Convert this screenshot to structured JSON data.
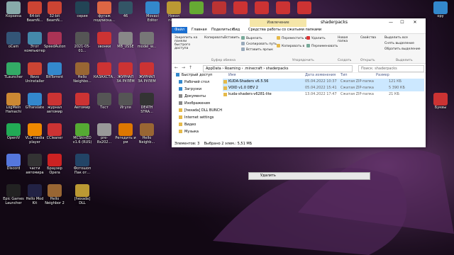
{
  "desktop": {
    "icons": [
      {
        "label": "Корзина",
        "color": "#8aa",
        "name": "recycle-bin-icon"
      },
      {
        "label": "64-bit\nBeamN...",
        "color": "#c43",
        "name": "beamng-64-icon"
      },
      {
        "label": "32-bit\nBeamN...",
        "color": "#c43",
        "name": "beamng-32-icon"
      },
      {
        "label": "серия",
        "color": "#245",
        "name": "folder-serial-icon"
      },
      {
        "label": "футаж\nподписка...",
        "color": "#d64",
        "name": "footage-icon"
      },
      {
        "label": "46",
        "color": "#356",
        "name": "file-46-icon"
      },
      {
        "label": "Movavi\nEditor",
        "color": "#38c",
        "name": "movavi-editor-icon"
      },
      {
        "label": "Новая\nпапка",
        "color": "#b93",
        "name": "new-folder-icon"
      },
      {
        "label": "",
        "color": "#6a3",
        "name": "winrar-icon"
      },
      {
        "label": "",
        "color": "#b33",
        "name": "game-archive-icon"
      },
      {
        "label": "",
        "color": "#c33",
        "name": "pdf-icon"
      },
      {
        "label": "",
        "color": "#c33",
        "name": "pdf-2-icon"
      },
      {
        "label": "",
        "color": "#c33",
        "name": "pdf-3-icon"
      },
      {
        "label": "",
        "color": "#c33",
        "name": "pdf-4-icon"
      },
      {
        "label": "oCam",
        "color": "#357",
        "name": "ocam-icon"
      },
      {
        "label": "Этот\nкомпьютер",
        "color": "#48a",
        "name": "this-pc-icon"
      },
      {
        "label": "SpeedAutom...",
        "color": "#a35",
        "name": "speedautom-icon"
      },
      {
        "label": "2021-05-01...",
        "color": "#555",
        "name": "video-file-icon"
      },
      {
        "label": "звонки",
        "color": "#c33",
        "name": "calls-icon"
      },
      {
        "label": "MB_USSE",
        "color": "#888",
        "name": "mb-usse-icon"
      },
      {
        "label": "model_w...",
        "color": "#777",
        "name": "model-w-icon"
      },
      {
        "label": "TLauncher",
        "color": "#3a6",
        "name": "tlauncher-icon"
      },
      {
        "label": "Revo\nUninstaller",
        "color": "#c43",
        "name": "revo-uninstaller-icon"
      },
      {
        "label": "BitTorrent",
        "color": "#38c",
        "name": "bittorrent-icon"
      },
      {
        "label": "Hello\nNeighbo...",
        "color": "#963",
        "name": "hello-neighbor-icon"
      },
      {
        "label": "КАЗАХСТА...",
        "color": "#c33",
        "name": "kazakhstan-pdf-icon"
      },
      {
        "label": "ЖУРНАЛ\nЗА РУЛЁМ",
        "color": "#c33",
        "name": "journal-pdf-icon"
      },
      {
        "label": "ЖУРНАЛ\nЗА РУЛЕМ",
        "color": "#c33",
        "name": "journal-pdf-2-icon"
      },
      {
        "label": "LogMeIn\nHamachi",
        "color": "#c83",
        "name": "hamachi-icon"
      },
      {
        "label": "GTranslate",
        "color": "#38c",
        "name": "gtranslate-icon"
      },
      {
        "label": "журнал\nавтомир",
        "color": "#c33",
        "name": "avtomir-pdf-icon"
      },
      {
        "label": "Автомир",
        "color": "#c33",
        "name": "avtomir-icon"
      },
      {
        "label": "Тест",
        "color": "#555",
        "name": "test-icon"
      },
      {
        "label": "Игуля",
        "color": "#555",
        "name": "igulya-icon"
      },
      {
        "label": "DEATH\nSTRA...",
        "color": "#333",
        "name": "death-stranding-icon"
      },
      {
        "label": "OpenIV",
        "color": "#2a5",
        "name": "openiv-icon"
      },
      {
        "label": "VLC media\nplayer",
        "color": "#e80",
        "name": "vlc-icon"
      },
      {
        "label": "CCleaner",
        "color": "#c33",
        "name": "ccleaner-icon"
      },
      {
        "label": "MCSkinED\nv1.6 (RUS)",
        "color": "#5a3",
        "name": "mcskined-icon"
      },
      {
        "label": "pre-8x202...",
        "color": "#999",
        "name": "pre-file-icon"
      },
      {
        "label": "Регедить и\nрм",
        "color": "#d70",
        "name": "regedit-icon"
      },
      {
        "label": "Hello\nNeighb...",
        "color": "#963",
        "name": "hello-neighbor-2-icon"
      },
      {
        "label": "Discord",
        "color": "#57d",
        "name": "discord-icon"
      },
      {
        "label": "части\nавтомира",
        "color": "#333",
        "name": "avtomir-parts-icon"
      },
      {
        "label": "Браузер\nOpera",
        "color": "#c22",
        "name": "opera-icon"
      },
      {
        "label": "Фотошоп\nПак от...",
        "color": "#246",
        "name": "photoshop-icon"
      },
      {
        "label": "Epic Games\nLauncher",
        "color": "#222",
        "name": "epic-games-icon"
      },
      {
        "label": "Hello Mod\nKit",
        "color": "#224",
        "name": "hello-mod-kit-icon"
      },
      {
        "label": "Hello\nNeighbor 2",
        "color": "#963",
        "name": "hello-neighbor-3-icon"
      },
      {
        "label": "[hexada] DLL\nBUNCH",
        "color": "#b93",
        "name": "dll-bunch-icon"
      },
      {
        "label": "ору",
        "color": "#38c",
        "name": "right-ory-icon"
      },
      {
        "label": "Буквы",
        "color": "#c33",
        "name": "right-bukvy-icon"
      }
    ],
    "tooltip": "Удалить"
  },
  "explorer": {
    "title": "shaderpacks",
    "context_tab": "Извлечение",
    "window_controls": [
      "—",
      "☐",
      "✕"
    ],
    "tabs": [
      "Файл",
      "Главная",
      "Поделиться",
      "Вид",
      "Средства работы со сжатыми папками"
    ],
    "ribbon": {
      "pin": "Закрепить на панели быстрого доступа",
      "copy": "Копировать",
      "paste": "Вставить",
      "cut": "Вырезать",
      "copy_path": "Скопировать путь",
      "paste_shortcut": "Вставить ярлык",
      "clipboard_group": "Буфер обмена",
      "move_to": "Переместить в",
      "copy_to": "Копировать в",
      "delete": "Удалить",
      "rename": "Переименовать",
      "organize_group": "Упорядочить",
      "new_folder": "Новая папка",
      "create_group": "Создать",
      "properties": "Свойства",
      "open_group": "Открыть",
      "select_all": "Выделить все",
      "select_none": "Снять выделение",
      "invert": "Обратить выделение",
      "select_group": "Выделить"
    },
    "address": {
      "path": [
        "AppData",
        "Roaming",
        ".minecraft",
        "shaderpacks"
      ],
      "search_placeholder": "Поиск: shaderpacks"
    },
    "sidebar": [
      {
        "label": "Быстрый доступ",
        "color": "#38c"
      },
      {
        "label": "Рабочий стол",
        "color": "#38c"
      },
      {
        "label": "Загрузки",
        "color": "#38c"
      },
      {
        "label": "Документы",
        "color": "#888"
      },
      {
        "label": "Изображения",
        "color": "#888"
      },
      {
        "label": "[hexada] DLL BUNCH",
        "color": "#e5b94a"
      },
      {
        "label": "Internet settings",
        "color": "#e5b94a"
      },
      {
        "label": "Видео",
        "color": "#e5b94a"
      },
      {
        "label": "Музыка",
        "color": "#e5b94a"
      }
    ],
    "columns": {
      "name": "Имя",
      "date": "Дата изменения",
      "type": "Тип",
      "size": "Размер"
    },
    "files": [
      {
        "name": "KUDA-Shaders v6.5.56",
        "date": "05.04.2022 10:37",
        "type": "Сжатая ZIP-папка",
        "size": "121 КБ",
        "selected": true
      },
      {
        "name": "VOID v1.0 DEV 2",
        "date": "05.04.2022 15:41",
        "type": "Сжатая ZIP-папка",
        "size": "5 390 КБ",
        "selected": true
      },
      {
        "name": "kuda-shaders-v6281-lite",
        "date": "13.04.2022 17:47",
        "type": "Сжатая ZIP-папка",
        "size": "21 КБ",
        "selected": false
      }
    ],
    "status": {
      "count": "Элементов: 3",
      "selected": "Выбрано 2 элем.: 5,51 МБ"
    }
  }
}
